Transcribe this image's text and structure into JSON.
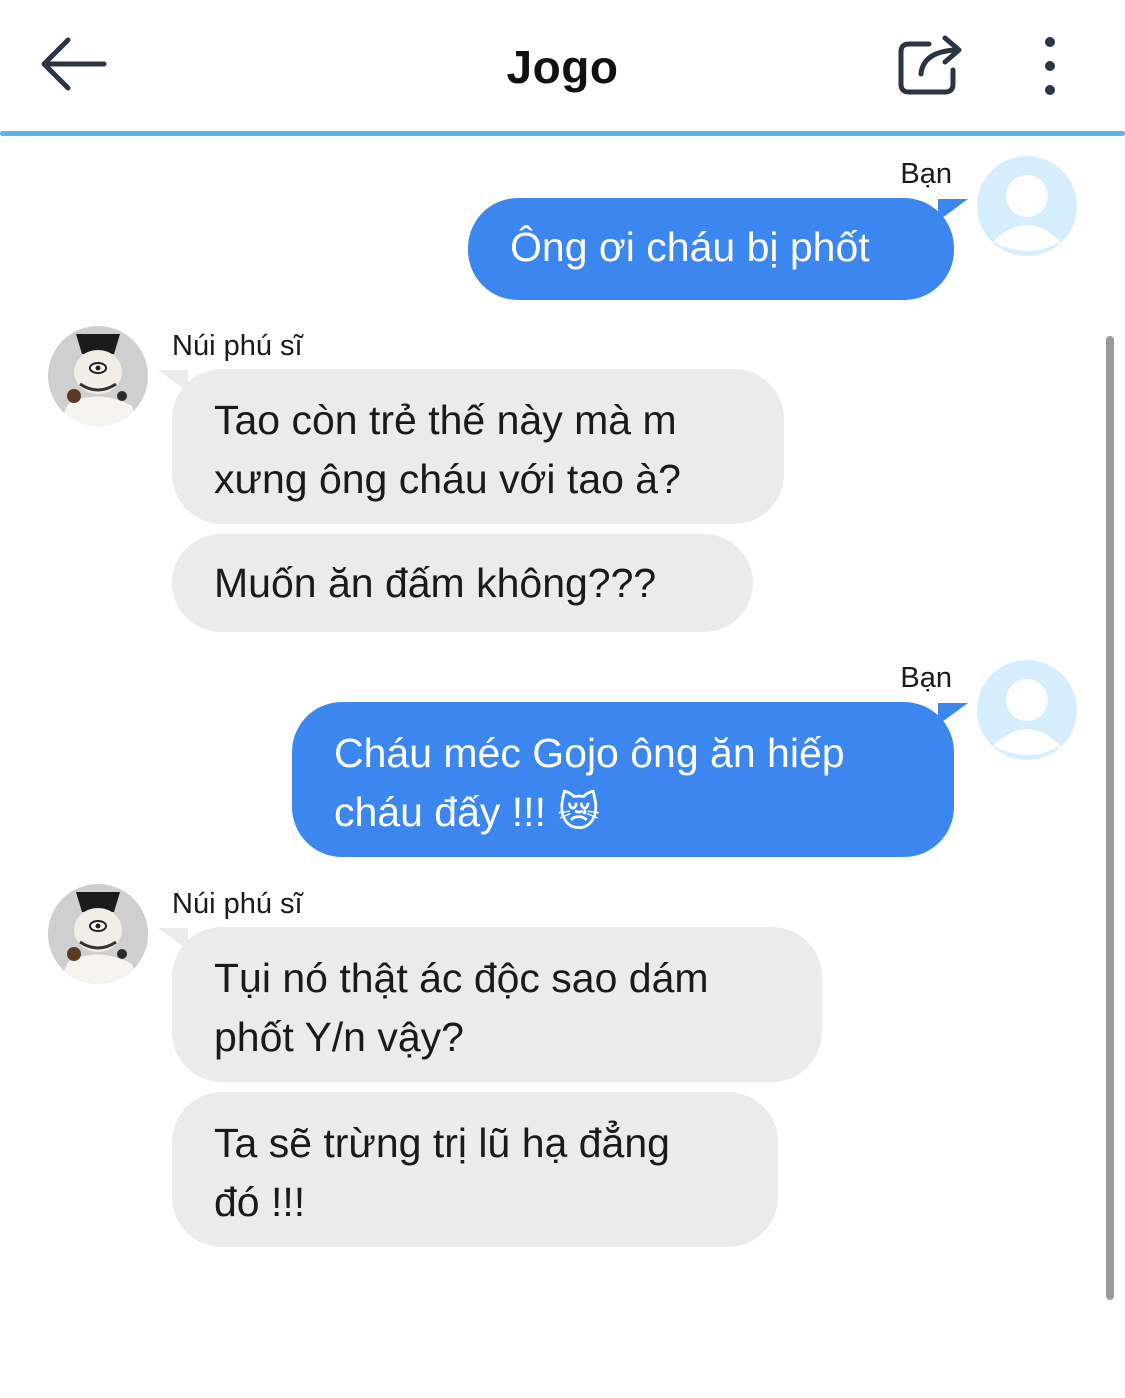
{
  "header": {
    "title": "Jogo",
    "back_icon": "arrow-left-icon",
    "share_icon": "share-icon",
    "more_icon": "more-vertical-icon"
  },
  "colors": {
    "outgoing_bubble": "#3c86ef",
    "incoming_bubble": "#ebebeb",
    "header_divider": "#5ab3ea",
    "user_avatar_bg": "#d6edfb"
  },
  "messages": [
    {
      "direction": "outgoing",
      "sender": "Bạn",
      "text": "Ông ơi cháu bị phốt"
    },
    {
      "direction": "incoming",
      "sender": "Núi phú sĩ",
      "texts": [
        "Tao còn trẻ thế này mà m xưng ông cháu với tao à?",
        "Muốn ăn đấm không???"
      ]
    },
    {
      "direction": "outgoing",
      "sender": "Bạn",
      "text": "Cháu méc Gojo ông ăn hiếp cháu đấy !!! 😿"
    },
    {
      "direction": "incoming",
      "sender": "Núi phú sĩ",
      "texts": [
        "Tụi nó thật ác độc sao dám phốt Y/n vậy?",
        "Ta sẽ trừng trị lũ hạ đẳng đó !!!"
      ]
    }
  ],
  "bubbles": {
    "m1": {
      "line1": "Ông ơi cháu bị phốt"
    },
    "m2": {
      "line1": "Tao còn trẻ thế này mà m",
      "line2": "xưng ông cháu với tao à?"
    },
    "m3": {
      "line1": "Muốn ăn đấm không???"
    },
    "m4": {
      "line1": "Cháu méc Gojo ông ăn hiếp",
      "line2": "cháu đấy !!! 😿"
    },
    "m5": {
      "line1": "Tụi nó thật ác độc sao dám",
      "line2": "phốt Y/n vậy?"
    },
    "m6": {
      "line1": "Ta sẽ trừng trị lũ hạ đẳng",
      "line2": "đó !!!"
    }
  },
  "senders": {
    "user": "Bạn",
    "bot": "Núi phú sĩ"
  }
}
